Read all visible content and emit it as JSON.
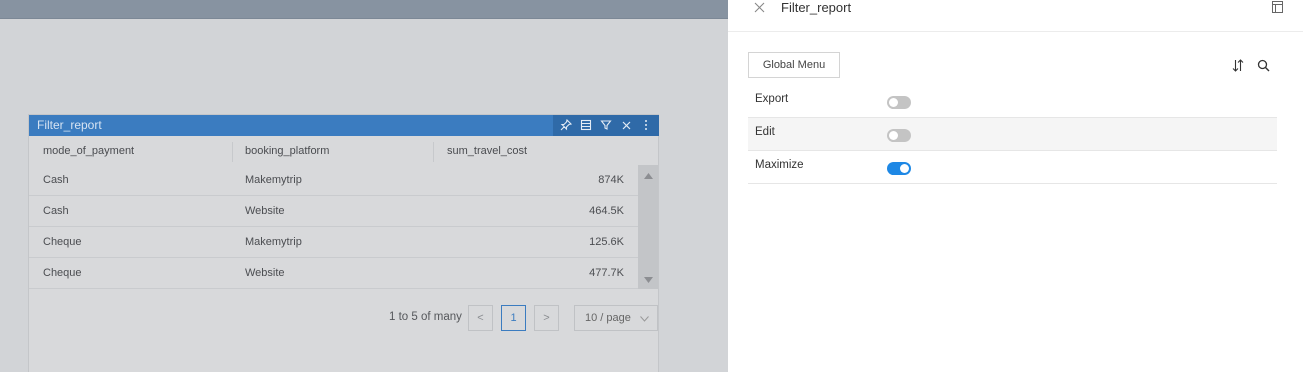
{
  "widget": {
    "title": "Filter_report",
    "columns": [
      "mode_of_payment",
      "booking_platform",
      "sum_travel_cost"
    ],
    "rows": [
      {
        "mode_of_payment": "Cash",
        "booking_platform": "Makemytrip",
        "sum_travel_cost": "874K"
      },
      {
        "mode_of_payment": "Cash",
        "booking_platform": "Website",
        "sum_travel_cost": "464.5K"
      },
      {
        "mode_of_payment": "Cheque",
        "booking_platform": "Makemytrip",
        "sum_travel_cost": "125.6K"
      },
      {
        "mode_of_payment": "Cheque",
        "booking_platform": "Website",
        "sum_travel_cost": "477.7K"
      }
    ],
    "pagination": {
      "summary": "1 to 5 of many",
      "current_page": "1",
      "page_size": "10 / page",
      "prev": "<",
      "next": ">"
    },
    "tool_icons": [
      "pin-icon",
      "table-icon",
      "filter-icon",
      "close-icon",
      "more-vertical-icon"
    ]
  },
  "panel": {
    "title": "Filter_report",
    "global_menu_label": "Global Menu",
    "options": [
      {
        "label": "Export",
        "enabled": false
      },
      {
        "label": "Edit",
        "enabled": false
      },
      {
        "label": "Maximize",
        "enabled": true
      }
    ],
    "toggle_on_color": "#1e88e5",
    "toggle_off_color": "#c4c4c4"
  },
  "colors": {
    "widget_header": "#3b7cc0",
    "widget_tools": "#2f6aa8"
  }
}
